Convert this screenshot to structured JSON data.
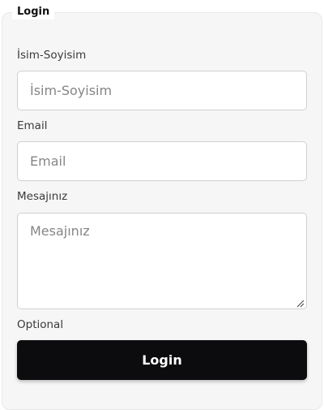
{
  "form": {
    "legend": "Login",
    "name_label": "İsim-Soyisim",
    "name_placeholder": "İsim-Soyisim",
    "email_label": "Email",
    "email_placeholder": "Email",
    "message_label": "Mesajınız",
    "message_placeholder": "Mesajınız",
    "message_hint": "Optional",
    "submit_label": "Login"
  }
}
